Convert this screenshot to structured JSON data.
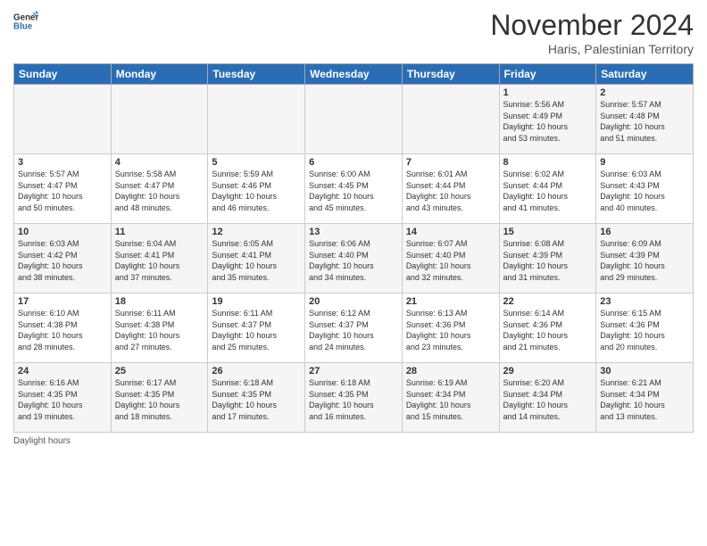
{
  "logo": {
    "line1": "General",
    "line2": "Blue"
  },
  "title": "November 2024",
  "location": "Haris, Palestinian Territory",
  "weekdays": [
    "Sunday",
    "Monday",
    "Tuesday",
    "Wednesday",
    "Thursday",
    "Friday",
    "Saturday"
  ],
  "footer": "Daylight hours",
  "weeks": [
    [
      {
        "day": "",
        "info": ""
      },
      {
        "day": "",
        "info": ""
      },
      {
        "day": "",
        "info": ""
      },
      {
        "day": "",
        "info": ""
      },
      {
        "day": "",
        "info": ""
      },
      {
        "day": "1",
        "info": "Sunrise: 5:56 AM\nSunset: 4:49 PM\nDaylight: 10 hours\nand 53 minutes."
      },
      {
        "day": "2",
        "info": "Sunrise: 5:57 AM\nSunset: 4:48 PM\nDaylight: 10 hours\nand 51 minutes."
      }
    ],
    [
      {
        "day": "3",
        "info": "Sunrise: 5:57 AM\nSunset: 4:47 PM\nDaylight: 10 hours\nand 50 minutes."
      },
      {
        "day": "4",
        "info": "Sunrise: 5:58 AM\nSunset: 4:47 PM\nDaylight: 10 hours\nand 48 minutes."
      },
      {
        "day": "5",
        "info": "Sunrise: 5:59 AM\nSunset: 4:46 PM\nDaylight: 10 hours\nand 46 minutes."
      },
      {
        "day": "6",
        "info": "Sunrise: 6:00 AM\nSunset: 4:45 PM\nDaylight: 10 hours\nand 45 minutes."
      },
      {
        "day": "7",
        "info": "Sunrise: 6:01 AM\nSunset: 4:44 PM\nDaylight: 10 hours\nand 43 minutes."
      },
      {
        "day": "8",
        "info": "Sunrise: 6:02 AM\nSunset: 4:44 PM\nDaylight: 10 hours\nand 41 minutes."
      },
      {
        "day": "9",
        "info": "Sunrise: 6:03 AM\nSunset: 4:43 PM\nDaylight: 10 hours\nand 40 minutes."
      }
    ],
    [
      {
        "day": "10",
        "info": "Sunrise: 6:03 AM\nSunset: 4:42 PM\nDaylight: 10 hours\nand 38 minutes."
      },
      {
        "day": "11",
        "info": "Sunrise: 6:04 AM\nSunset: 4:41 PM\nDaylight: 10 hours\nand 37 minutes."
      },
      {
        "day": "12",
        "info": "Sunrise: 6:05 AM\nSunset: 4:41 PM\nDaylight: 10 hours\nand 35 minutes."
      },
      {
        "day": "13",
        "info": "Sunrise: 6:06 AM\nSunset: 4:40 PM\nDaylight: 10 hours\nand 34 minutes."
      },
      {
        "day": "14",
        "info": "Sunrise: 6:07 AM\nSunset: 4:40 PM\nDaylight: 10 hours\nand 32 minutes."
      },
      {
        "day": "15",
        "info": "Sunrise: 6:08 AM\nSunset: 4:39 PM\nDaylight: 10 hours\nand 31 minutes."
      },
      {
        "day": "16",
        "info": "Sunrise: 6:09 AM\nSunset: 4:39 PM\nDaylight: 10 hours\nand 29 minutes."
      }
    ],
    [
      {
        "day": "17",
        "info": "Sunrise: 6:10 AM\nSunset: 4:38 PM\nDaylight: 10 hours\nand 28 minutes."
      },
      {
        "day": "18",
        "info": "Sunrise: 6:11 AM\nSunset: 4:38 PM\nDaylight: 10 hours\nand 27 minutes."
      },
      {
        "day": "19",
        "info": "Sunrise: 6:11 AM\nSunset: 4:37 PM\nDaylight: 10 hours\nand 25 minutes."
      },
      {
        "day": "20",
        "info": "Sunrise: 6:12 AM\nSunset: 4:37 PM\nDaylight: 10 hours\nand 24 minutes."
      },
      {
        "day": "21",
        "info": "Sunrise: 6:13 AM\nSunset: 4:36 PM\nDaylight: 10 hours\nand 23 minutes."
      },
      {
        "day": "22",
        "info": "Sunrise: 6:14 AM\nSunset: 4:36 PM\nDaylight: 10 hours\nand 21 minutes."
      },
      {
        "day": "23",
        "info": "Sunrise: 6:15 AM\nSunset: 4:36 PM\nDaylight: 10 hours\nand 20 minutes."
      }
    ],
    [
      {
        "day": "24",
        "info": "Sunrise: 6:16 AM\nSunset: 4:35 PM\nDaylight: 10 hours\nand 19 minutes."
      },
      {
        "day": "25",
        "info": "Sunrise: 6:17 AM\nSunset: 4:35 PM\nDaylight: 10 hours\nand 18 minutes."
      },
      {
        "day": "26",
        "info": "Sunrise: 6:18 AM\nSunset: 4:35 PM\nDaylight: 10 hours\nand 17 minutes."
      },
      {
        "day": "27",
        "info": "Sunrise: 6:18 AM\nSunset: 4:35 PM\nDaylight: 10 hours\nand 16 minutes."
      },
      {
        "day": "28",
        "info": "Sunrise: 6:19 AM\nSunset: 4:34 PM\nDaylight: 10 hours\nand 15 minutes."
      },
      {
        "day": "29",
        "info": "Sunrise: 6:20 AM\nSunset: 4:34 PM\nDaylight: 10 hours\nand 14 minutes."
      },
      {
        "day": "30",
        "info": "Sunrise: 6:21 AM\nSunset: 4:34 PM\nDaylight: 10 hours\nand 13 minutes."
      }
    ]
  ]
}
